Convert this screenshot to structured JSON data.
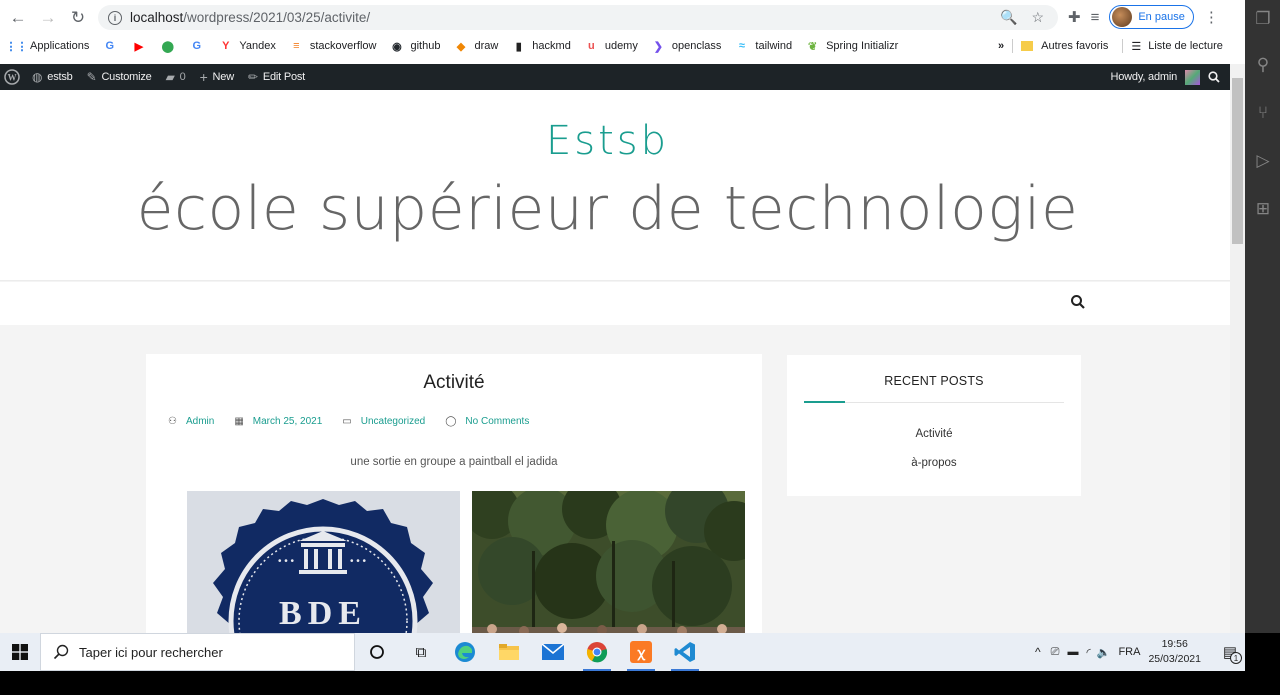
{
  "browser": {
    "url_host": "localhost",
    "url_path": "/wordpress/2021/03/25/activite/",
    "profile_label": "En pause",
    "bookmarks": [
      {
        "label": "Applications",
        "icon": "apps-grid-icon",
        "color": "#1a73e8"
      },
      {
        "label": "",
        "icon": "google-icon",
        "color": "#4285f4"
      },
      {
        "label": "",
        "icon": "youtube-icon",
        "color": "#ff0000"
      },
      {
        "label": "",
        "icon": "maps-icon",
        "color": "#34a853"
      },
      {
        "label": "",
        "icon": "google-icon",
        "color": "#4285f4"
      },
      {
        "label": "Yandex",
        "icon": "yandex-icon",
        "color": "#ff3333"
      },
      {
        "label": "stackoverflow",
        "icon": "stackoverflow-icon",
        "color": "#f48024"
      },
      {
        "label": "github",
        "icon": "github-icon",
        "color": "#24292e"
      },
      {
        "label": "draw",
        "icon": "drawio-icon",
        "color": "#f08705"
      },
      {
        "label": "hackmd",
        "icon": "hackmd-icon",
        "color": "#222"
      },
      {
        "label": "udemy",
        "icon": "udemy-icon",
        "color": "#ec5252"
      },
      {
        "label": "openclass",
        "icon": "openclass-icon",
        "color": "#7451eb"
      },
      {
        "label": "tailwind",
        "icon": "tailwind-icon",
        "color": "#38bdf8"
      },
      {
        "label": "Spring Initializr",
        "icon": "spring-icon",
        "color": "#6db33f"
      }
    ],
    "more_label": "»",
    "other_favorites": "Autres favoris",
    "reading_list": "Liste de lecture"
  },
  "adminbar": {
    "site": "estsb",
    "customize": "Customize",
    "comments": "0",
    "new": "New",
    "edit_post": "Edit Post",
    "howdy": "Howdy, admin"
  },
  "site": {
    "title": "Estsb",
    "description": "école supérieur de technologie"
  },
  "post": {
    "title": "Activité",
    "author": "Admin",
    "date": "March 25, 2021",
    "category": "Uncategorized",
    "comments": "No Comments",
    "excerpt": "une sortie en groupe a paintball el jadida",
    "image_1_text": "BDE"
  },
  "sidebar": {
    "widget_title": "RECENT POSTS",
    "recent_posts": [
      "Activité",
      "à-propos"
    ]
  },
  "taskbar": {
    "search_placeholder": "Taper ici pour rechercher",
    "language": "FRA",
    "time": "19:56",
    "date": "25/03/2021",
    "notification_count": "1"
  },
  "colors": {
    "accent": "#1a9d8f",
    "admin_bar": "#1d2327",
    "page_bg": "#f4f4f4"
  }
}
